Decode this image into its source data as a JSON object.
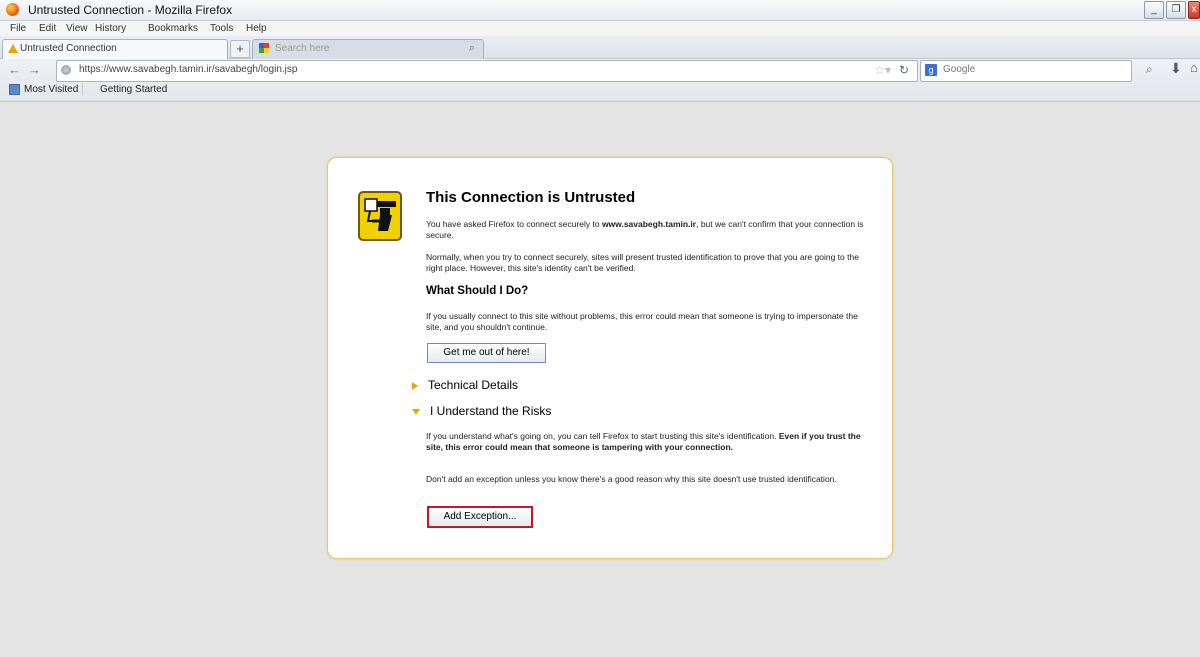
{
  "window": {
    "title": "Untrusted Connection - Mozilla Firefox",
    "buttons": {
      "minimize": "_",
      "maximize": "❐",
      "close": "x"
    }
  },
  "menu": [
    "File",
    "Edit",
    "View",
    "History",
    "Bookmarks",
    "Tools",
    "Help"
  ],
  "tabs": {
    "active_label": "Untrusted Connection",
    "new_tab": "+",
    "search_placeholder": "Search here",
    "search_icon": "search-icon"
  },
  "navigation": {
    "url": "https://www.savabegh.tamin.ir/savabegh/login.jsp",
    "search_engine": "Google"
  },
  "bookmarks": [
    "Most Visited",
    "Getting Started"
  ],
  "error_page": {
    "title": "This Connection is Untrusted",
    "para1_prefix": "You have asked Firefox to connect securely to ",
    "para1_host": "www.savabegh.tamin.ir",
    "para1_suffix": ", but we can't confirm that your connection is secure.",
    "para2": "Normally, when you try to connect securely, sites will present trusted identification to prove that you are going to the right place. However, this site's identity can't be verified.",
    "what_should_heading": "What Should I Do?",
    "para3": "If you usually connect to this site without problems, this error could mean that someone is trying to impersonate the site, and you shouldn't continue.",
    "get_out_button": "Get me out of here!",
    "technical_details": "Technical Details",
    "understand_risks": "I Understand the Risks",
    "para4_prefix": "If you understand what's going on, you can tell Firefox to start trusting this site's identification. ",
    "para4_bold": "Even if you trust the site, this error could mean that someone is tampering with your connection.",
    "para5": "Don't add an exception unless you know there's a good reason why this site doesn't use trusted identification.",
    "add_exception_button": "Add Exception..."
  },
  "colors": {
    "warning_yellow": "#e6a800",
    "box_border": "#e8c86c",
    "highlight_red": "#c21829"
  }
}
